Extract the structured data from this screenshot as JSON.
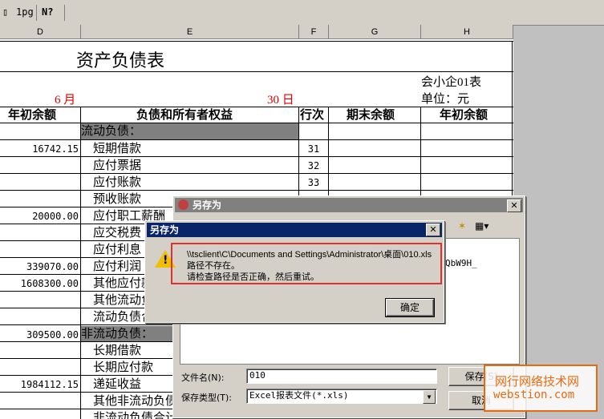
{
  "toolbar": {
    "item1": "1pg",
    "item2": "N?"
  },
  "columns": [
    "D",
    "E",
    "F",
    "G",
    "H"
  ],
  "sheet": {
    "title": "资产负债表",
    "form_code": "会小企01表",
    "unit": "单位：元",
    "month": "6 月",
    "day": "30 日",
    "headers": {
      "col_d": "年初余额",
      "col_e": "负债和所有者权益",
      "col_f": "行次",
      "col_g": "期末余额",
      "col_h": "年初余额"
    },
    "section_current": "流动负债：",
    "section_noncurrent": "非流动负债：",
    "rows": [
      {
        "d": "16742.15",
        "e": "短期借款",
        "f": "31"
      },
      {
        "d": "",
        "e": "应付票据",
        "f": "32"
      },
      {
        "d": "",
        "e": "应付账款",
        "f": "33"
      },
      {
        "d": "",
        "e": "预收账款",
        "f": ""
      },
      {
        "d": "20000.00",
        "e": "应付职工薪酬",
        "f": ""
      },
      {
        "d": "",
        "e": "应交税费",
        "f": ""
      },
      {
        "d": "",
        "e": "应付利息",
        "f": ""
      },
      {
        "d": "339070.00",
        "e": "应付利润",
        "f": ""
      },
      {
        "d": "1608300.00",
        "e": "其他应付款",
        "f": ""
      },
      {
        "d": "",
        "e": "其他流动负债",
        "f": ""
      },
      {
        "d": "",
        "e": "流动负债合计",
        "f": ""
      }
    ],
    "row_noncurrent_d": "309500.00",
    "rows2": [
      {
        "d": "",
        "e": "长期借款"
      },
      {
        "d": "",
        "e": "长期应付款"
      },
      {
        "d": "1984112.15",
        "e": "递延收益"
      },
      {
        "d": "",
        "e": "其他非流动负债"
      },
      {
        "d": "",
        "e": "非流动负债合计"
      }
    ]
  },
  "save_dialog": {
    "title": "另存为",
    "filename_label": "文件名(N):",
    "filename_value": "010",
    "filetype_label": "保存类型(T):",
    "filetype_value": "Excel报表文件(*.xls)",
    "save_button": "保存(S)",
    "cancel_button": "取消",
    "partial_text": "QbW9H_"
  },
  "error_dialog": {
    "title": "另存为",
    "path": "\\\\tsclient\\C\\Documents and Settings\\Administrator\\桌面\\010.xls",
    "line2": "路径不存在。",
    "line3": "请检查路径是否正确，然后重试。",
    "ok_button": "确定"
  },
  "watermark": {
    "line1": "网行网络技术网",
    "line2": "webstion.com"
  },
  "colors": {
    "caption_active": "#0a246a",
    "caption_inactive": "#808080",
    "red_text": "#e00000",
    "highlight_border": "#e03030",
    "watermark": "#e86a10"
  }
}
